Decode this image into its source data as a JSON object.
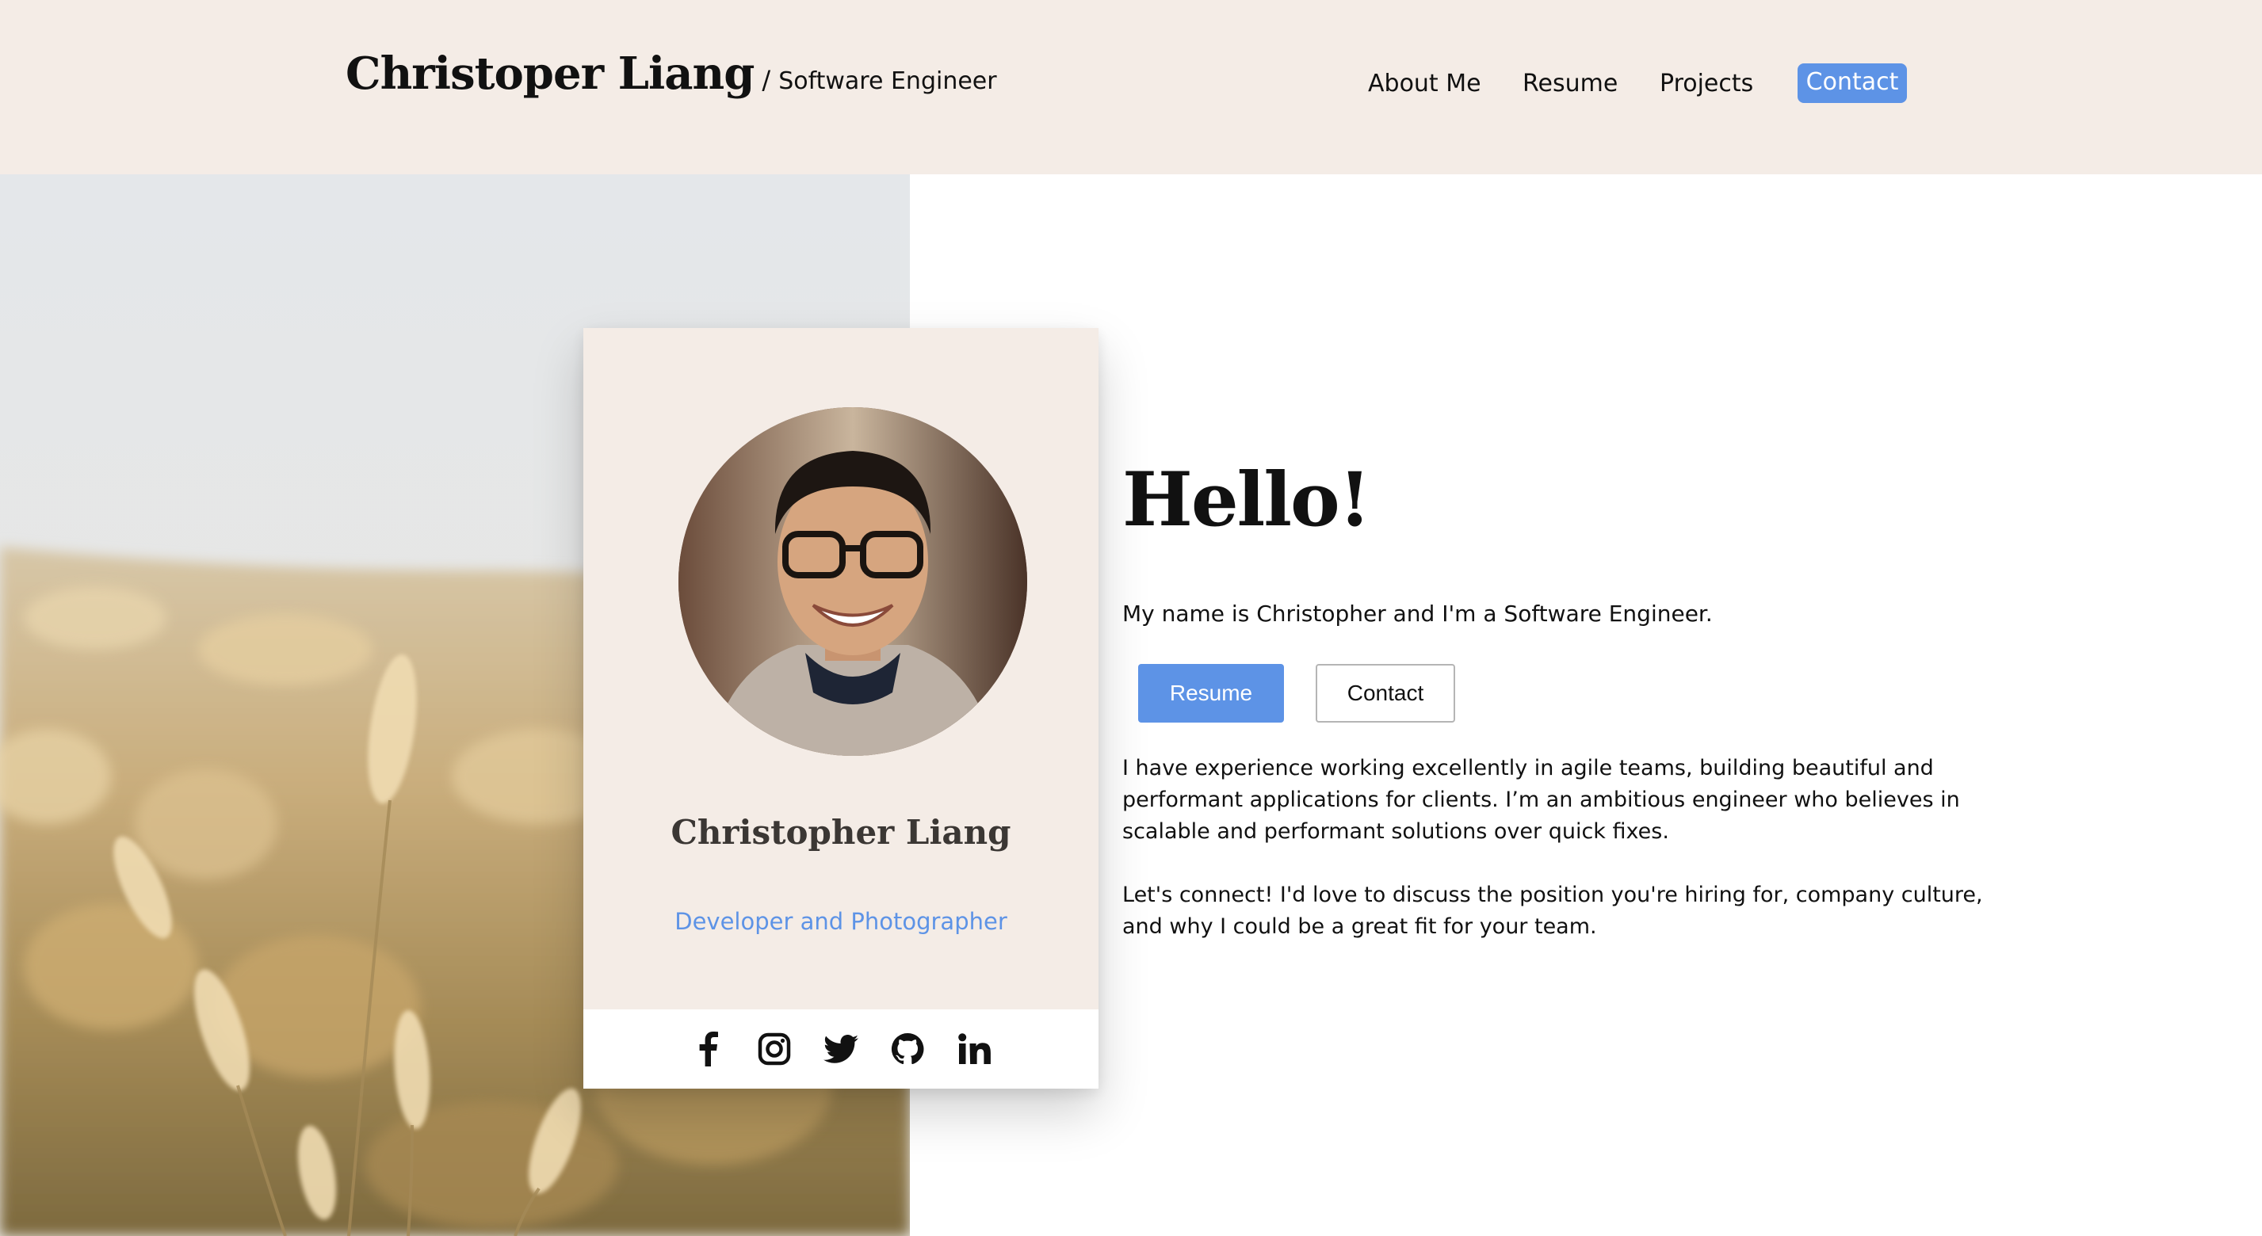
{
  "header": {
    "brand_name": "Christoper Liang",
    "separator": "/",
    "role": "Software Engineer",
    "background_color": "#f4ece6",
    "nav": [
      {
        "label": "About Me"
      },
      {
        "label": "Resume"
      },
      {
        "label": "Projects"
      },
      {
        "label": "Contact",
        "active": true
      }
    ]
  },
  "card": {
    "name": "Christopher Liang",
    "tagline": "Developer and Photographer",
    "social": [
      {
        "icon": "facebook-icon"
      },
      {
        "icon": "instagram-icon"
      },
      {
        "icon": "twitter-icon"
      },
      {
        "icon": "github-icon"
      },
      {
        "icon": "linkedin-icon"
      }
    ]
  },
  "intro": {
    "heading": "Hello!",
    "subtitle": "My name is Christopher and I'm a Software Engineer.",
    "buttons": {
      "resume": "Resume",
      "contact": "Contact"
    },
    "paragraph_1": "I have experience working excellently in agile teams, building beautiful and performant applications for clients. I’m an ambitious engineer who believes in scalable and performant solutions over quick fixes.",
    "paragraph_2": "Let's connect! I'd love to discuss the position you're hiring for, company culture, and why I could be a great fit for your team."
  },
  "colors": {
    "accent": "#5d93e6",
    "beige": "#f4ece6",
    "text": "#111111"
  }
}
